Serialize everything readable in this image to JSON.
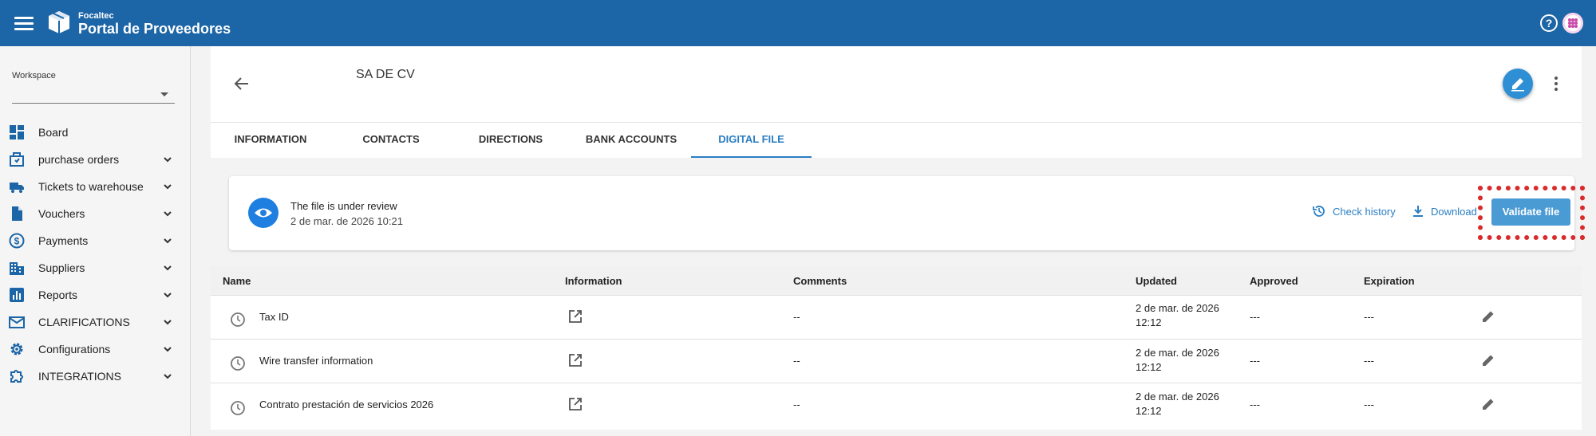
{
  "header": {
    "brand_small": "Focaltec",
    "brand_title": "Portal de Proveedores",
    "accent": "#1c65a6"
  },
  "sidebar": {
    "workspace_label": "Workspace",
    "workspace_value": "",
    "items": [
      {
        "label": "Board",
        "icon": "dashboard-icon"
      },
      {
        "label": "purchase orders",
        "icon": "purchase-orders-icon"
      },
      {
        "label": "Tickets to warehouse",
        "icon": "truck-icon"
      },
      {
        "label": "Vouchers",
        "icon": "document-icon"
      },
      {
        "label": "Payments",
        "icon": "dollar-icon"
      },
      {
        "label": "Suppliers",
        "icon": "building-icon"
      },
      {
        "label": "Reports",
        "icon": "chart-icon"
      },
      {
        "label": "CLARIFICATIONS",
        "icon": "mail-icon"
      },
      {
        "label": "Configurations",
        "icon": "gear-icon"
      },
      {
        "label": "INTEGRATIONS",
        "icon": "puzzle-icon"
      }
    ]
  },
  "supplier": {
    "name": "SA DE CV"
  },
  "tabs": [
    {
      "label": "INFORMATION"
    },
    {
      "label": "CONTACTS"
    },
    {
      "label": "DIRECTIONS"
    },
    {
      "label": "BANK ACCOUNTS"
    },
    {
      "label": "DIGITAL FILE",
      "active": true
    }
  ],
  "status": {
    "title": "The file is under review",
    "date": "2 de mar. de 2026 10:21",
    "check_history": "Check history",
    "download": "Download",
    "validate": "Validate file"
  },
  "table": {
    "columns": [
      "Name",
      "Information",
      "Comments",
      "Updated",
      "Approved",
      "Expiration"
    ],
    "rows": [
      {
        "name": "Tax ID",
        "comments": "--",
        "updated_date": "2 de mar. de 2026",
        "updated_time": "12:12",
        "approved": "---",
        "expiration": "---"
      },
      {
        "name": "Wire transfer information",
        "comments": "--",
        "updated_date": "2 de mar. de 2026",
        "updated_time": "12:12",
        "approved": "---",
        "expiration": "---"
      },
      {
        "name": "Contrato prestación de servicios 2026",
        "comments": "--",
        "updated_date": "2 de mar. de 2026",
        "updated_time": "12:12",
        "approved": "---",
        "expiration": "---"
      }
    ]
  }
}
